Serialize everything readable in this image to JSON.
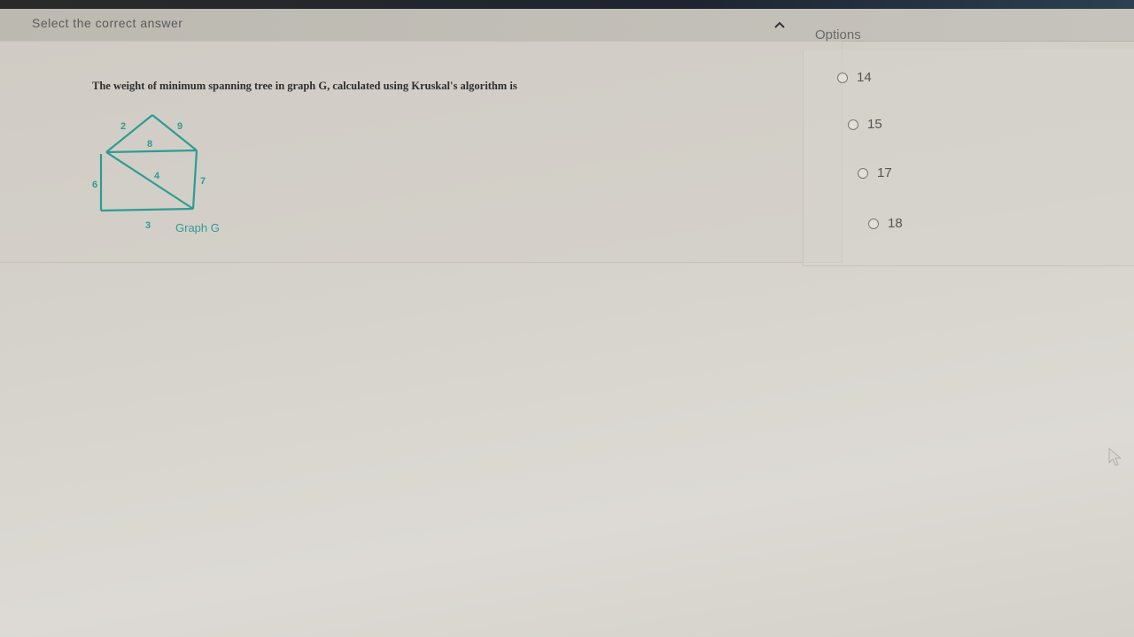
{
  "header": {
    "title": "Select the correct answer"
  },
  "options_panel": {
    "title": "Options",
    "options": [
      {
        "label": "14"
      },
      {
        "label": "15"
      },
      {
        "label": "17"
      },
      {
        "label": "18"
      }
    ]
  },
  "question": {
    "text": "The weight of minimum spanning tree in graph G, calculated using Kruskal's algorithm is",
    "graph": {
      "caption": "Graph G",
      "edge_weights": [
        "2",
        "9",
        "8",
        "4",
        "6",
        "7",
        "3"
      ],
      "color": "#2f9c92"
    }
  },
  "icons": {
    "collapse": "chevron-up-icon",
    "cursor": "mouse-pointer-icon"
  }
}
